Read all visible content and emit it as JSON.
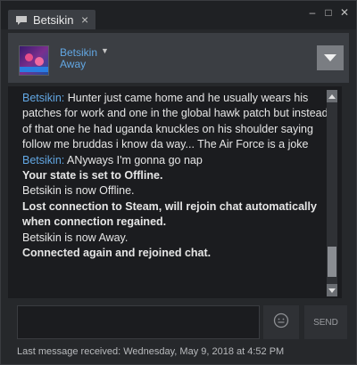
{
  "tab": {
    "title": "Betsikin",
    "close_glyph": "×"
  },
  "window_controls": {
    "minimize": "–",
    "maximize": "□",
    "close": "✕"
  },
  "friend": {
    "name": "Betsikin",
    "status": "Away"
  },
  "messages": [
    {
      "kind": "chat",
      "sender": "Betsikin:",
      "text": " Hunter just came home and he usually wears his patches for work and one in the global hawk patch but instead of that one he had uganda knuckles on his shoulder saying follow me bruddas i know da way... The Air Force is a joke"
    },
    {
      "kind": "chat",
      "sender": "Betsikin:",
      "text": " ANyways I'm gonna go nap"
    },
    {
      "kind": "system_bold",
      "text": "Your state is set to Offline."
    },
    {
      "kind": "system",
      "text": "Betsikin is now Offline."
    },
    {
      "kind": "system_bold",
      "text": "Lost connection to Steam, will rejoin chat automatically when connection regained."
    },
    {
      "kind": "system",
      "text": "Betsikin is now Away."
    },
    {
      "kind": "system_bold",
      "text": "Connected again and rejoined chat."
    }
  ],
  "input": {
    "value": "",
    "placeholder": ""
  },
  "send_label": "SEND",
  "footer": "Last message received: Wednesday, May 9, 2018 at 4:52 PM",
  "icons": {
    "tab": "chat-bubble-icon",
    "menu": "dropdown-triangle-icon",
    "emoji": "emoticon-icon"
  },
  "colors": {
    "name_blue": "#62a7e3",
    "chat_bg": "#1b1c1f",
    "panel_bg": "#3b3e43"
  }
}
